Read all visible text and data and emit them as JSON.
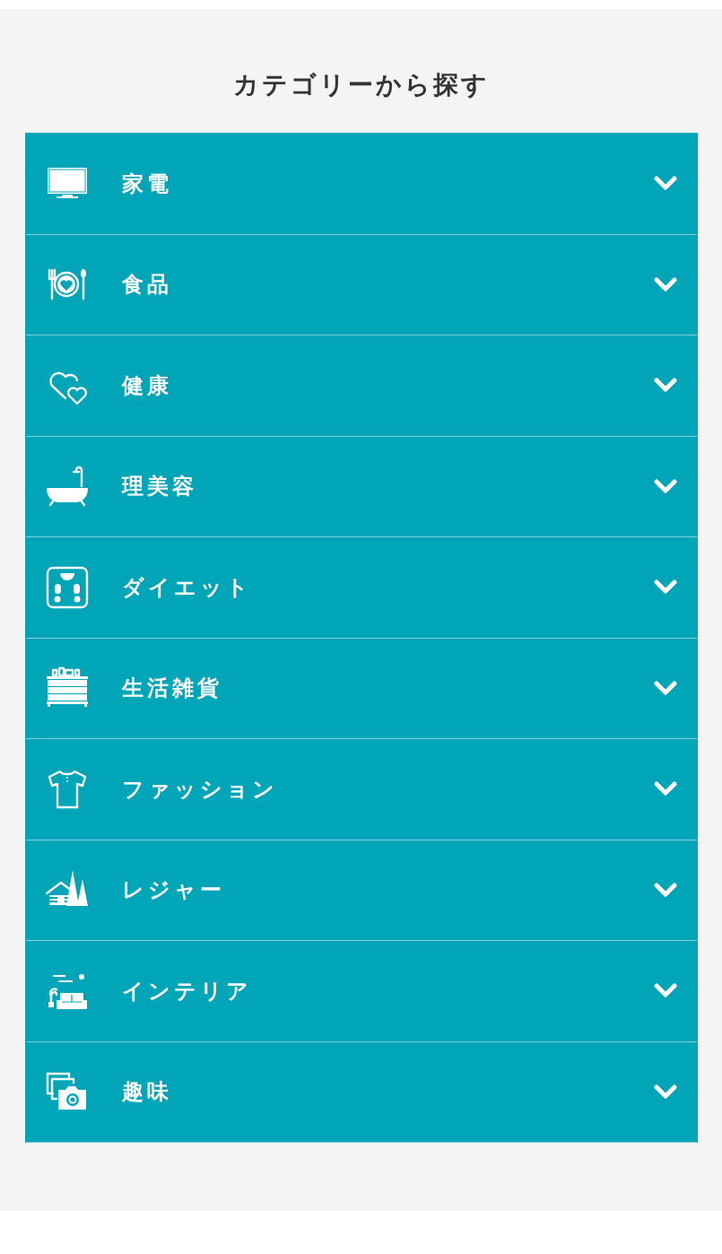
{
  "title": "カテゴリーから探す",
  "categories": [
    {
      "label": "家電",
      "expanded": false
    },
    {
      "label": "食品",
      "expanded": false
    },
    {
      "label": "健康",
      "expanded": false
    },
    {
      "label": "理美容",
      "expanded": false
    },
    {
      "label": "ダイエット",
      "expanded": false
    },
    {
      "label": "生活雑貨",
      "expanded": false
    },
    {
      "label": "ファッション",
      "expanded": false
    },
    {
      "label": "レジャー",
      "expanded": false
    },
    {
      "label": "インテリア",
      "expanded": false
    },
    {
      "label": "趣味",
      "expanded": false
    }
  ]
}
